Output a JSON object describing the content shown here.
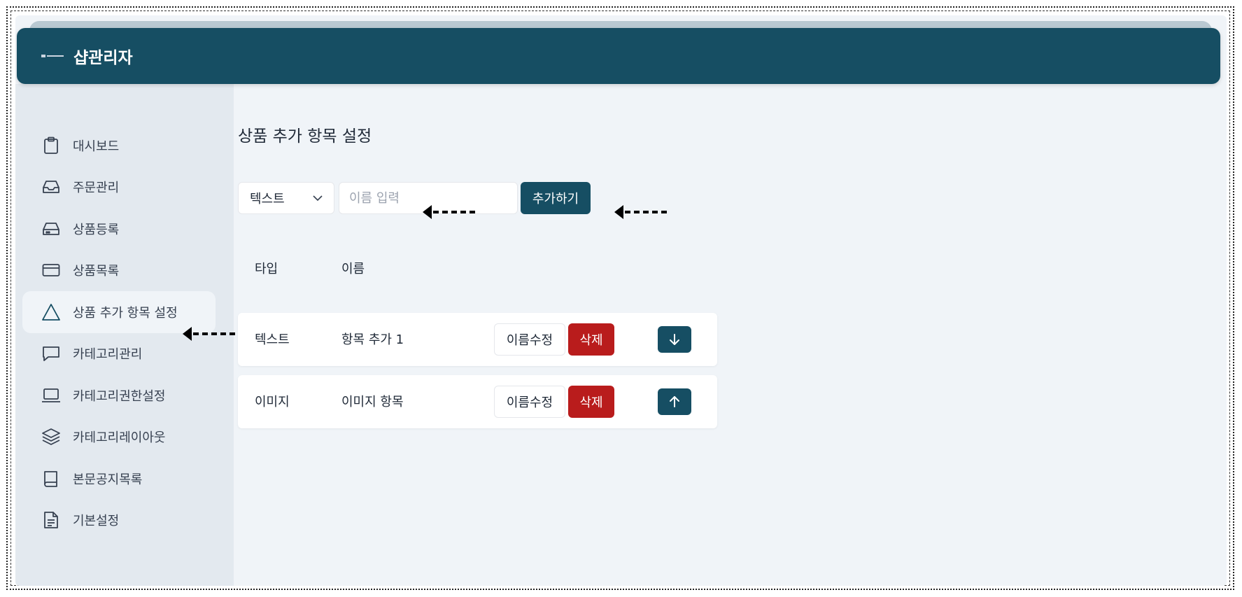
{
  "header": {
    "title": "샵관리자",
    "logo_icon": "shop-logo-icon"
  },
  "sidebar": {
    "items": [
      {
        "label": "대시보드",
        "icon": "clipboard-icon"
      },
      {
        "label": "주문관리",
        "icon": "inbox-icon"
      },
      {
        "label": "상품등록",
        "icon": "hard-drive-icon"
      },
      {
        "label": "상품목록",
        "icon": "credit-card-icon"
      },
      {
        "label": "상품 추가 항목 설정",
        "icon": "triangle-icon",
        "active": true
      },
      {
        "label": "카테고리관리",
        "icon": "message-square-icon"
      },
      {
        "label": "카테고리권한설정",
        "icon": "laptop-icon"
      },
      {
        "label": "카테고리레이아웃",
        "icon": "layers-icon"
      },
      {
        "label": "본문공지목록",
        "icon": "book-icon"
      },
      {
        "label": "기본설정",
        "icon": "file-text-icon"
      }
    ]
  },
  "main": {
    "page_title": "상품 추가 항목 설정",
    "form": {
      "type_select_value": "텍스트",
      "name_placeholder": "이름 입력",
      "add_button_label": "추가하기"
    },
    "table": {
      "headers": [
        "타입",
        "이름"
      ],
      "rows": [
        {
          "type": "텍스트",
          "name": "항목 추가 1",
          "rename_label": "이름수정",
          "delete_label": "삭제",
          "move_icon": "arrow-down-icon"
        },
        {
          "type": "이미지",
          "name": "이미지 항목",
          "rename_label": "이름수정",
          "delete_label": "삭제",
          "move_icon": "arrow-up-icon"
        }
      ]
    }
  },
  "colors": {
    "primary": "#164e63",
    "danger": "#b91c1c",
    "sidebar_bg": "#e3e9ef",
    "content_bg": "#f0f4f8"
  }
}
